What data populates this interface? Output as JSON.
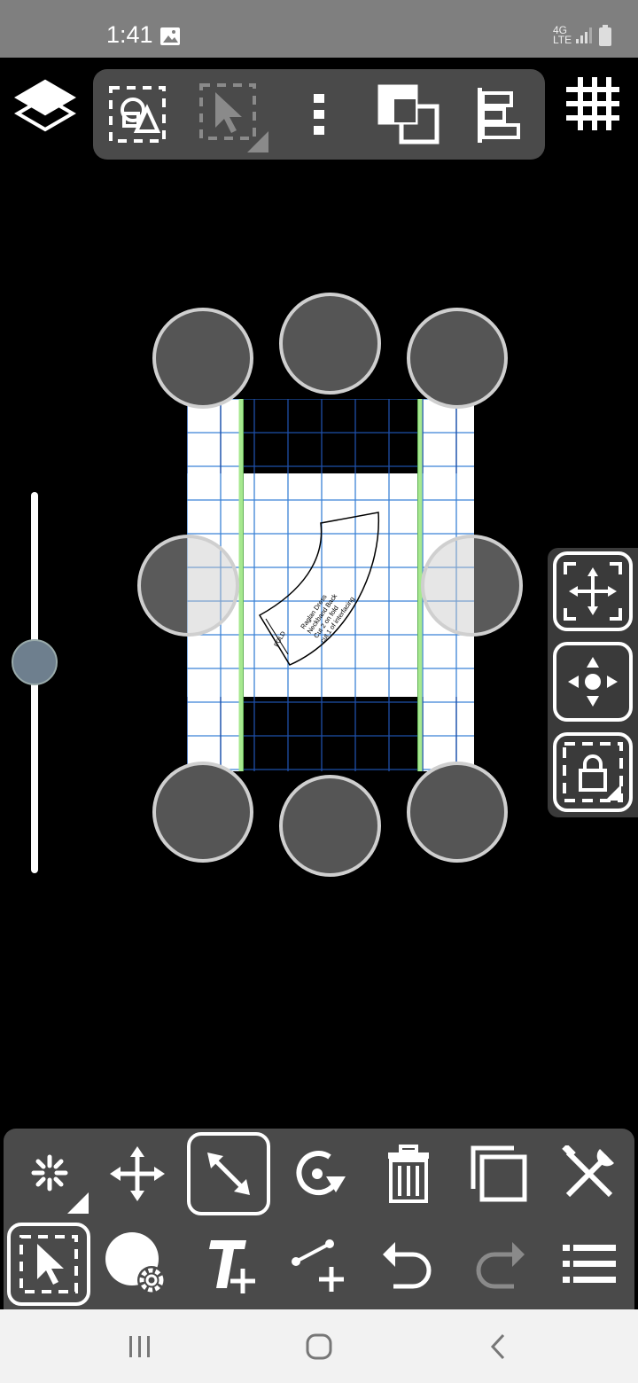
{
  "status_bar": {
    "time": "1:41",
    "network_label": "4G LTE",
    "icons": [
      "image-icon",
      "network-type-icon",
      "signal-icon",
      "battery-icon"
    ]
  },
  "top_toolbar": {
    "buttons": [
      "select-by-shape-icon",
      "select-region-icon",
      "more-options-icon",
      "layer-order-icon",
      "align-icon"
    ]
  },
  "layers_button": {
    "icon": "layers-icon"
  },
  "grid_button": {
    "icon": "grid-icon"
  },
  "pattern_piece": {
    "lines": [
      "Raglan Dress",
      "Neckband Back",
      "Cut 2 on fold",
      "cut 1 of interfacing"
    ],
    "fold_label": "FOLD"
  },
  "zoom_slider": {
    "value": 0.44
  },
  "side_panel": {
    "buttons": [
      "fit-to-screen-icon",
      "pan-icon",
      "lock-aspect-icon"
    ]
  },
  "bottom_toolbar": {
    "row1": [
      "magic-select-icon",
      "move-icon",
      "scale-icon",
      "rotate-icon",
      "delete-icon",
      "duplicate-icon",
      "tools-icon"
    ],
    "row2": [
      "select-icon",
      "fill-settings-icon",
      "add-text-icon",
      "add-line-icon",
      "undo-icon",
      "redo-icon",
      "menu-list-icon"
    ],
    "selected": [
      "scale-icon",
      "select-icon"
    ]
  },
  "nav_bar": {
    "buttons": [
      "recent-apps-icon",
      "home-icon",
      "back-icon"
    ]
  },
  "colors": {
    "toolbar_bg": "#4a4a4a",
    "grid_line": "#3b82d6",
    "selection_green": "#1f7a1f",
    "bright_green": "#a6e88f"
  }
}
